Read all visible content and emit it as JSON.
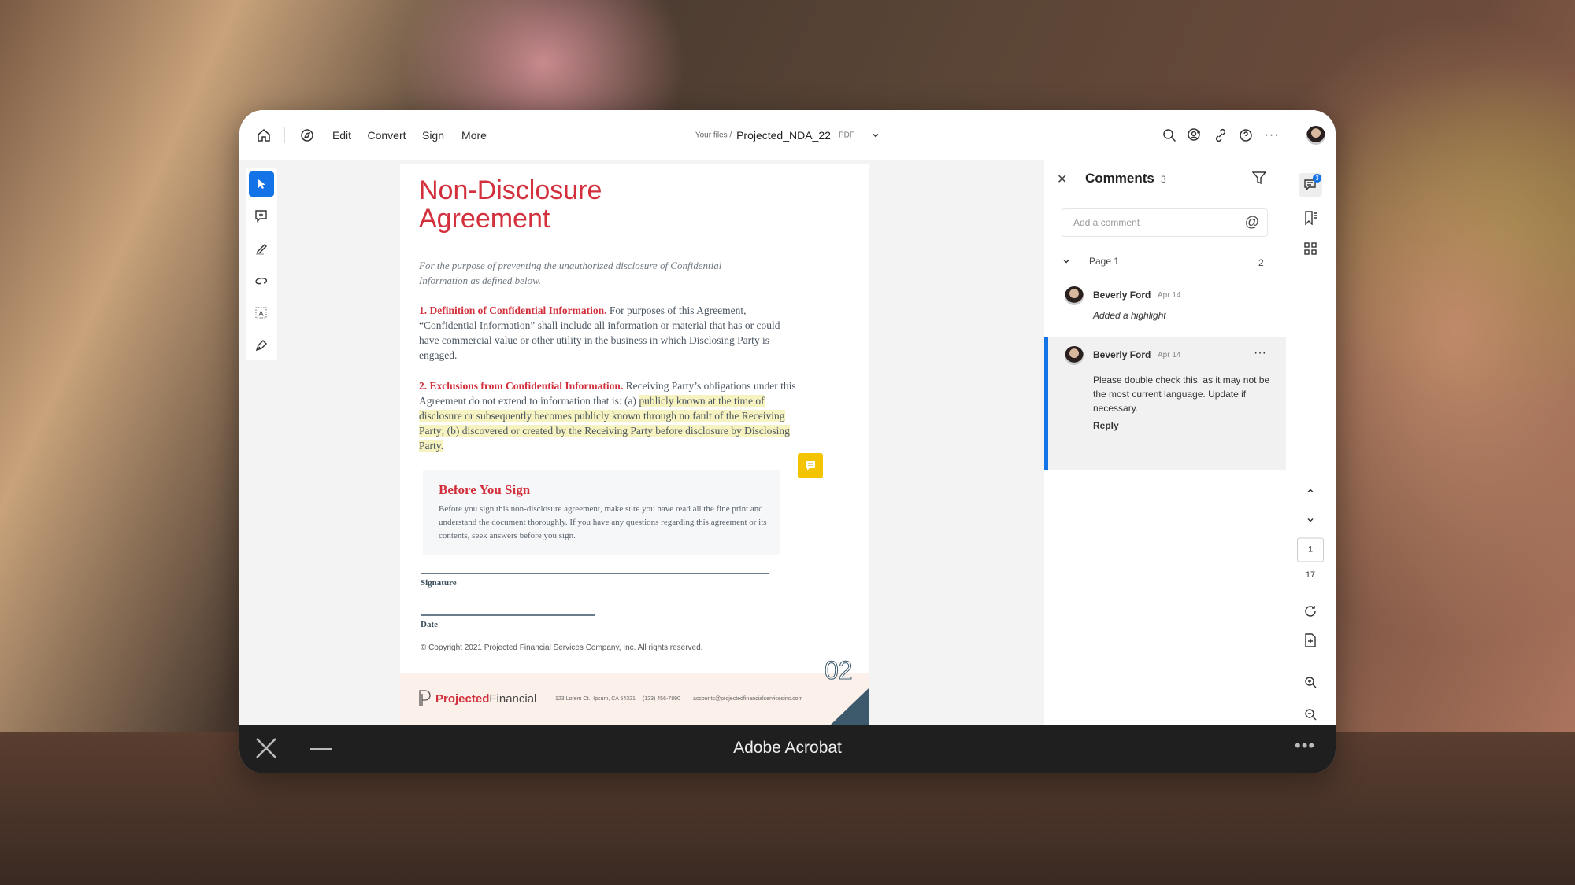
{
  "header": {
    "menu": [
      "Edit",
      "Convert",
      "Sign",
      "More"
    ],
    "breadcrumb_prefix": "Your files /",
    "file_name": "Projected_NDA_22",
    "file_type": "PDF"
  },
  "document": {
    "title_line1": "Non-Disclosure",
    "title_line2": "Agreement",
    "intro": "For the purpose of preventing the unauthorized disclosure of Confidential Information as defined below.",
    "section1_heading": "1. Definition of Confidential Information.",
    "section1_text": " For purposes of this Agreement, “Confidential Information” shall include all information or material that has or could have commercial value or other utility in the business in which Disclosing Party is engaged.",
    "section2_heading": "2. Exclusions from Confidential Information.",
    "section2_text": " Receiving Party’s obligations under this Agreement do not extend to information that is: (a) ",
    "section2_highlight": "publicly known at the time of disclosure or subsequently becomes publicly known through no fault of the Receiving Party; (b) discovered or created by the Receiving Party before disclosure by Disclosing Party.",
    "callout_title": "Before You Sign",
    "callout_text": "Before you sign this non-disclosure agreement, make sure you have read all the fine print and understand the document thoroughly. If you have any questions regarding this agreement or its contents, seek answers before you sign.",
    "signature_label": "Signature",
    "date_label": "Date",
    "copyright": "© Copyright 2021 Projected Financial Services Company, Inc. All rights reserved.",
    "page_number": "02",
    "footer": {
      "logo_bold": "Projected",
      "logo_light": "Financial",
      "address": "123 Lorem Ct., Ipsum, CA 54321",
      "phone": "(123) 456-7890",
      "email": "accounts@projectedfinancialservicesinc.com"
    }
  },
  "comments": {
    "title": "Comments",
    "count": "3",
    "placeholder": "Add a comment",
    "group_label": "Page 1",
    "group_count": "2",
    "items": [
      {
        "author": "Beverly Ford",
        "date": "Apr 14",
        "text": "Added a highlight"
      },
      {
        "author": "Beverly Ford",
        "date": "Apr 14",
        "text": "Please double check this, as it may not be the most current language. Update if necessary.",
        "reply": "Reply"
      }
    ]
  },
  "right_rail": {
    "comment_badge": "3",
    "current_page": "1",
    "total_pages": "17"
  },
  "app_bar": {
    "title": "Adobe Acrobat"
  },
  "colors": {
    "accent": "#1473e6",
    "doc_red": "#d2303c",
    "highlight": "#f7f3c0",
    "note": "#f5c400"
  }
}
